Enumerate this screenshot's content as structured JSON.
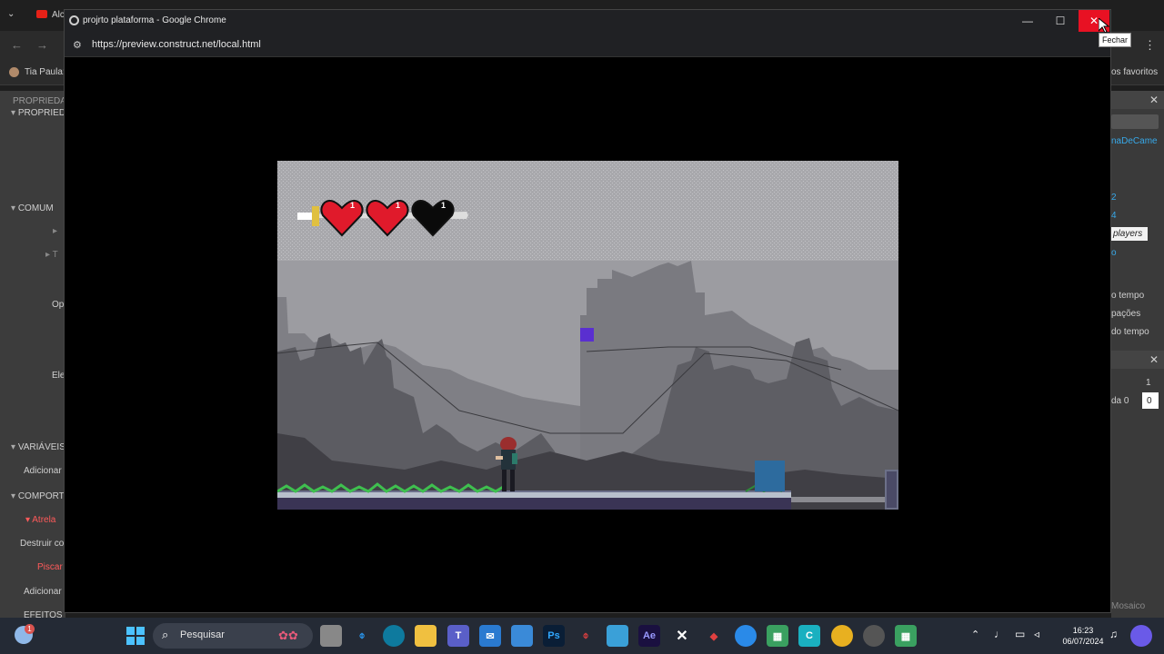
{
  "background_browser": {
    "tab_title": "Alc",
    "bookmark": "Tia Paula:",
    "favorites": "os favoritos"
  },
  "editor_left": {
    "items": [
      "PROPRIEDA",
      "PROPRIED",
      "COMUM",
      "T",
      "Op",
      "Ele",
      "VARIÁVEIS",
      "Adicionar",
      "COMPORT",
      "Atrela",
      "Destruir co",
      "Piscar",
      "Adicionar",
      "EFEITOS"
    ]
  },
  "editor_right": {
    "items": [
      "naDeCame",
      "2",
      "4",
      "players",
      "o",
      "o tempo",
      "pações",
      "do tempo",
      "1",
      "da 0",
      "0",
      "Mosaico"
    ]
  },
  "window": {
    "title": "projrto plataforma - Google Chrome",
    "url": "https://preview.construct.net/local.html",
    "minimize": "—",
    "maximize": "☐",
    "close": "✕",
    "close_tooltip": "Fechar"
  },
  "game": {
    "hearts": [
      {
        "state": "full",
        "color": "#e01a2b"
      },
      {
        "state": "full",
        "color": "#e01a2b"
      },
      {
        "state": "empty",
        "color": "#0a0a0a"
      }
    ],
    "heart_numbers": [
      "1",
      "1",
      "1"
    ]
  },
  "taskbar": {
    "search_placeholder": "Pesquisar",
    "time": "16:23",
    "date": "06/07/2024",
    "notification_badge": "1"
  }
}
